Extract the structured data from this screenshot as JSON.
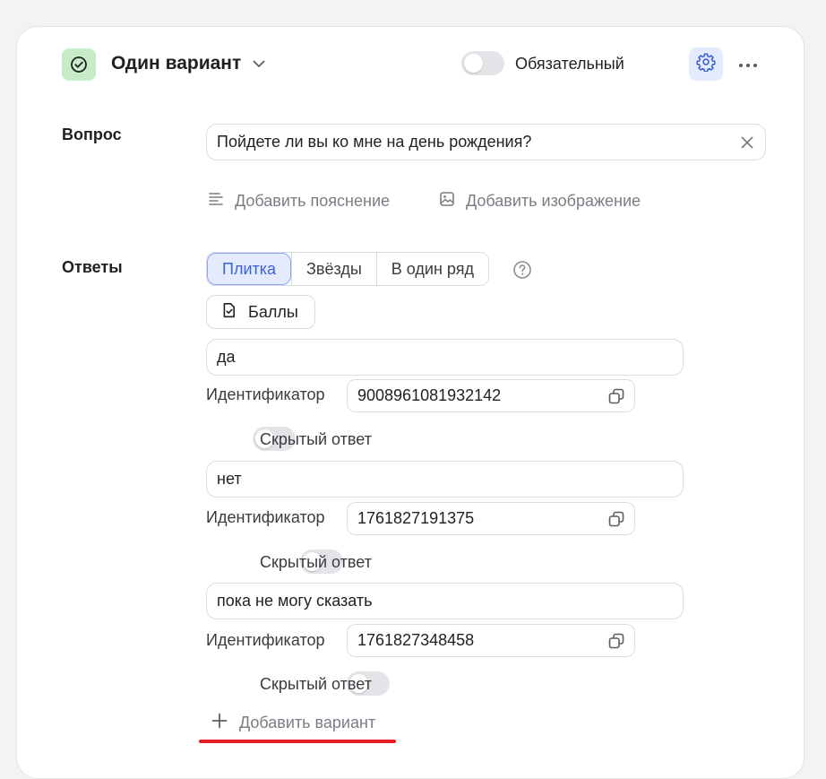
{
  "header": {
    "type_label": "Один вариант",
    "required_label": "Обязательный",
    "required_on": false
  },
  "question": {
    "label": "Вопрос",
    "value": "Пойдете ли вы ко мне на день рождения?",
    "add_description": "Добавить пояснение",
    "add_image": "Добавить изображение"
  },
  "answers": {
    "label": "Ответы",
    "view_tabs": [
      "Плитка",
      "Звёзды",
      "В один ряд"
    ],
    "active_tab": "Плитка",
    "score_button": "Баллы",
    "id_label": "Идентификатор",
    "hidden_label": "Скрытый ответ",
    "items": [
      {
        "text": "да",
        "id": "9008961081932142",
        "hidden": false
      },
      {
        "text": "нет",
        "id": "1761827191375",
        "hidden": false
      },
      {
        "text": "пока не могу сказать",
        "id": "1761827348458",
        "hidden": false
      }
    ],
    "add_variant": "Добавить вариант"
  },
  "icons": {
    "type": "check-circle-icon",
    "chevron": "chevron-down-icon",
    "settings": "gear-icon",
    "more": "more-horizontal-icon",
    "clear": "close-icon",
    "description": "text-lines-icon",
    "image": "image-icon",
    "help": "question-circle-icon",
    "score": "document-check-icon",
    "copy": "copy-icon",
    "add": "plus-icon"
  },
  "colors": {
    "accent": "#3c64d8",
    "type_badge": "#c7ecc8",
    "highlight_underline": "#e51c23"
  }
}
